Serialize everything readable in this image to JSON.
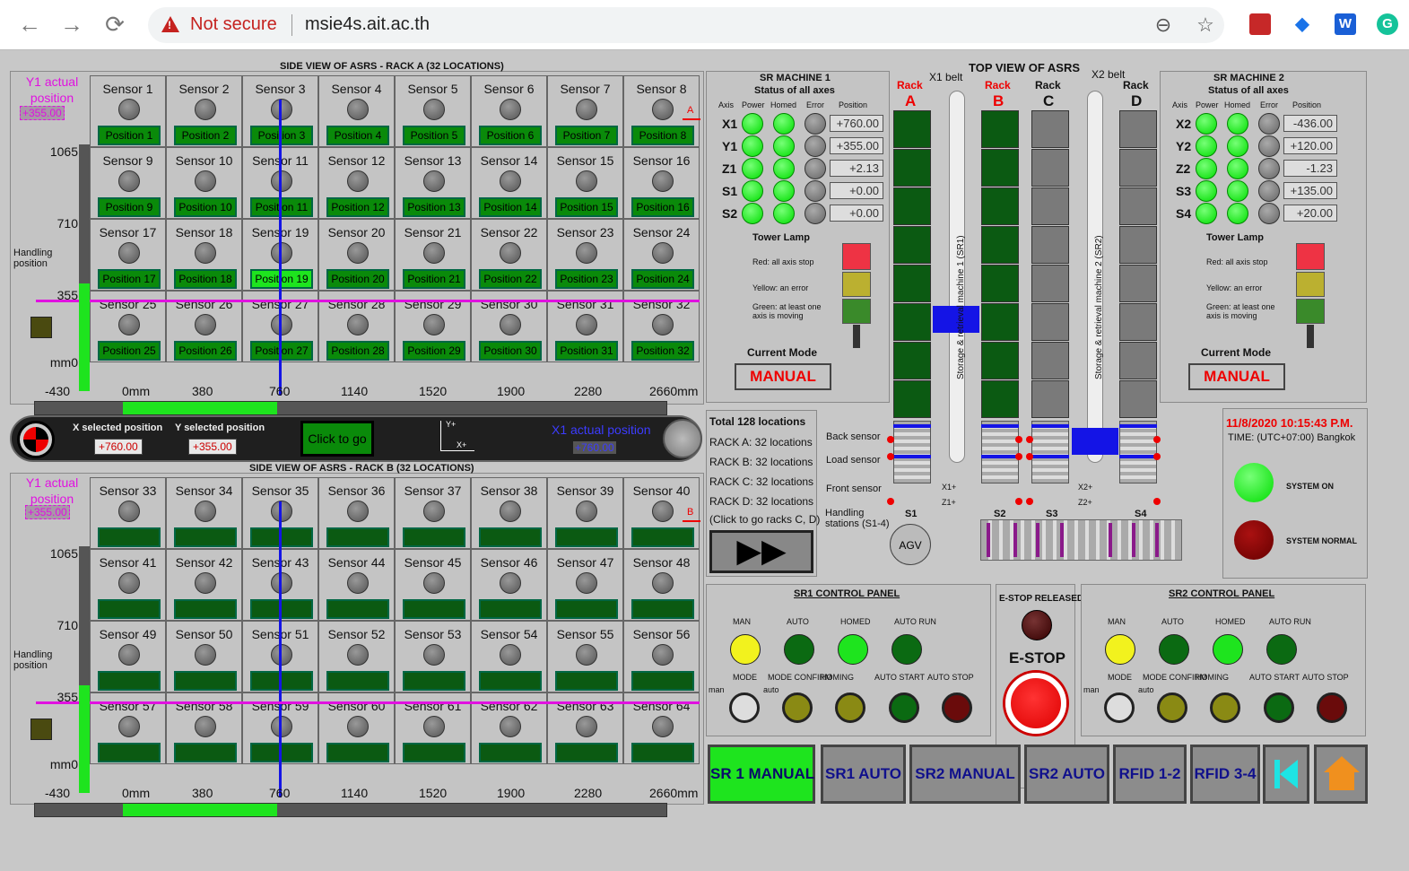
{
  "browser": {
    "back_icon": "←",
    "forward_icon": "→",
    "reload_icon": "⟳",
    "warning": "Not secure",
    "url": "msie4s.ait.ac.th"
  },
  "colors": {
    "green_position": "#0a8a0a",
    "selected_position": "#1ee41e",
    "magenta": "#e011e0",
    "blue": "#1414e6"
  },
  "rackA": {
    "title": "SIDE VIEW OF ASRS - RACK A (32 LOCATIONS)",
    "sensors": [
      "Sensor 1",
      "Sensor 2",
      "Sensor 3",
      "Sensor 4",
      "Sensor 5",
      "Sensor 6",
      "Sensor 7",
      "Sensor 8",
      "Sensor 9",
      "Sensor 10",
      "Sensor 11",
      "Sensor 12",
      "Sensor 13",
      "Sensor 14",
      "Sensor 15",
      "Sensor 16",
      "Sensor 17",
      "Sensor 18",
      "Sensor 19",
      "Sensor 20",
      "Sensor 21",
      "Sensor 22",
      "Sensor 23",
      "Sensor 24",
      "Sensor 25",
      "Sensor 26",
      "Sensor 27",
      "Sensor 28",
      "Sensor 29",
      "Sensor 30",
      "Sensor 31",
      "Sensor 32"
    ],
    "positions": [
      "Position 1",
      "Position 2",
      "Position 3",
      "Position 4",
      "Position 5",
      "Position 6",
      "Position 7",
      "Position 8",
      "Position 9",
      "Position 10",
      "Position 11",
      "Position 12",
      "Position 13",
      "Position 14",
      "Position 15",
      "Position 16",
      "Position 17",
      "Position 18",
      "Position 19",
      "Position 20",
      "Position 21",
      "Position 22",
      "Position 23",
      "Position 24",
      "Position 25",
      "Position 26",
      "Position 27",
      "Position 28",
      "Position 29",
      "Position 30",
      "Position 31",
      "Position 32"
    ],
    "selected_index": 18,
    "marker": "A"
  },
  "rackB": {
    "title": "SIDE VIEW OF ASRS - RACK B (32 LOCATIONS)",
    "sensors": [
      "Sensor 33",
      "Sensor 34",
      "Sensor 35",
      "Sensor 36",
      "Sensor 37",
      "Sensor 38",
      "Sensor 39",
      "Sensor 40",
      "Sensor 41",
      "Sensor 42",
      "Sensor 43",
      "Sensor 44",
      "Sensor 45",
      "Sensor 46",
      "Sensor 47",
      "Sensor 48",
      "Sensor 49",
      "Sensor 50",
      "Sensor 51",
      "Sensor 52",
      "Sensor 53",
      "Sensor 54",
      "Sensor 55",
      "Sensor 56",
      "Sensor 57",
      "Sensor 58",
      "Sensor 59",
      "Sensor 60",
      "Sensor 61",
      "Sensor 62",
      "Sensor 63",
      "Sensor 64"
    ],
    "marker": "B"
  },
  "axis": {
    "y": [
      "1065",
      "710",
      "355",
      "mm0"
    ],
    "x": [
      "-430",
      "0mm",
      "380",
      "760",
      "1140",
      "1520",
      "1900",
      "2280",
      "2660mm"
    ],
    "y_actual_label": "Y1 actual position",
    "y_actual_value": "+355.00",
    "handling": "Handling position"
  },
  "selector": {
    "x_label": "X selected position",
    "x_value": "+760.00",
    "y_label": "Y selected position",
    "y_value": "+355.00",
    "go": "Click to go",
    "x1_label": "X1 actual position",
    "x1_value": "+760.00",
    "yplus": "Y+",
    "xplus": "X+"
  },
  "sr1": {
    "title": "SR MACHINE 1",
    "subtitle": "Status of all axes",
    "cols": [
      "Axis",
      "Power",
      "Homed",
      "Error",
      "Position"
    ],
    "axes": [
      {
        "name": "X1",
        "pos": "+760.00"
      },
      {
        "name": "Y1",
        "pos": "+355.00"
      },
      {
        "name": "Z1",
        "pos": "+2.13"
      },
      {
        "name": "S1",
        "pos": "+0.00"
      },
      {
        "name": "S2",
        "pos": "+0.00"
      }
    ],
    "lamp": "Tower Lamp",
    "red": "Red: all axis stop",
    "yellow": "Yellow: an error",
    "green": "Green: at least one axis is moving",
    "mode_label": "Current Mode",
    "mode": "MANUAL"
  },
  "sr2": {
    "title": "SR MACHINE 2",
    "subtitle": "Status of all axes",
    "cols": [
      "Axis",
      "Power",
      "Homed",
      "Error",
      "Position"
    ],
    "axes": [
      {
        "name": "X2",
        "pos": "-436.00"
      },
      {
        "name": "Y2",
        "pos": "+120.00"
      },
      {
        "name": "Z2",
        "pos": "-1.23"
      },
      {
        "name": "S3",
        "pos": "+135.00"
      },
      {
        "name": "S4",
        "pos": "+20.00"
      }
    ],
    "lamp": "Tower Lamp",
    "red": "Red: all axis stop",
    "yellow": "Yellow: an error",
    "green": "Green: at least one axis is moving",
    "mode_label": "Current Mode",
    "mode": "MANUAL"
  },
  "top": {
    "title": "TOP VIEW OF ASRS",
    "x1belt": "X1 belt",
    "x2belt": "X2 belt",
    "rack": "Rack",
    "A": "A",
    "B": "B",
    "C": "C",
    "D": "D",
    "sr1": "Storage & retrieval machine 1 (SR1)",
    "sr2": "Storage & retrieval machine 2 (SR2)",
    "back": "Back sensor",
    "load": "Load sensor",
    "front": "Front sensor",
    "handling": "Handling stations (S1-4)",
    "agv": "AGV",
    "s1": "S1",
    "s2": "S2",
    "s3": "S3",
    "s4": "S4",
    "x1p": "X1+",
    "z1p": "Z1+",
    "x2p": "X2+",
    "z2p": "Z2+"
  },
  "locations": {
    "total": "Total 128 locations",
    "a": "RACK A: 32 locations",
    "b": "RACK B: 32 locations",
    "c": "RACK C: 32 locations",
    "d": "RACK D: 32 locations",
    "hint": "(Click to go racks C, D)"
  },
  "status": {
    "datetime": "11/8/2020 10:15:43 P.M.",
    "tz": "TIME: (UTC+07:00) Bangkok",
    "on": "SYSTEM ON",
    "normal": "SYSTEM NORMAL"
  },
  "cp1": {
    "title": "SR1 CONTROL PANEL",
    "man": "MAN",
    "auto": "AUTO",
    "homed": "HOMED",
    "autorun": "AUTO RUN",
    "mode": "MODE",
    "confirm": "MODE CONFIRM",
    "homing": "HOMING",
    "astart": "AUTO START",
    "astop": "AUTO STOP",
    "mman": "man",
    "mauto": "auto"
  },
  "cp2": {
    "title": "SR2 CONTROL PANEL",
    "man": "MAN",
    "auto": "AUTO",
    "homed": "HOMED",
    "autorun": "AUTO RUN",
    "mode": "MODE",
    "confirm": "MODE CONFIRM",
    "homing": "HOMING",
    "astart": "AUTO START",
    "astop": "AUTO STOP",
    "mman": "man",
    "mauto": "auto"
  },
  "estop": {
    "released": "E-STOP RELEASED",
    "label": "E-STOP"
  },
  "nav": [
    "SR 1 MANUAL",
    "SR1 AUTO",
    "SR2 MANUAL",
    "SR2 AUTO",
    "RFID 1-2",
    "RFID 3-4"
  ]
}
